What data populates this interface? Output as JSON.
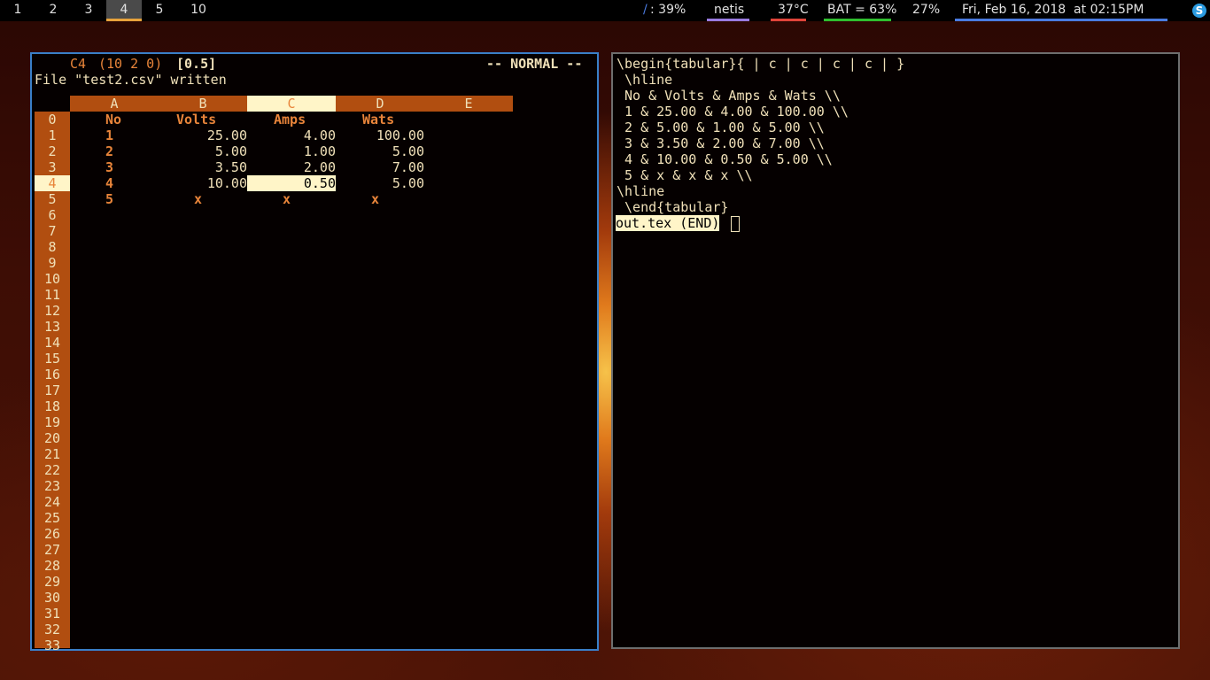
{
  "topbar": {
    "workspaces": [
      {
        "label": "1",
        "active": false
      },
      {
        "label": "2",
        "active": false
      },
      {
        "label": "3",
        "active": false
      },
      {
        "label": "4",
        "active": true
      },
      {
        "label": "5",
        "active": false
      },
      {
        "label": "10",
        "active": false
      }
    ],
    "disk": {
      "icon": "/",
      "value": ": 39%"
    },
    "net": "netis",
    "temp": "37°C",
    "battery": "BAT = 63%",
    "volume": "27%",
    "datetime": "Fri, Feb 16, 2018  at 02:15PM",
    "tray_icon": "skype-icon",
    "colors": {
      "net": "#9a7be0",
      "temp": "#e0443a",
      "battery": "#2fbf2f",
      "datetime": "#4a7be0",
      "disk_icon": "#4a7be0"
    }
  },
  "spreadsheet": {
    "status_cell": "C4",
    "status_info": "(10 2 0)",
    "status_value": "[0.5]",
    "mode": "-- NORMAL --",
    "message": "File \"test2.csv\" written",
    "columns": [
      "A",
      "B",
      "C",
      "D",
      "E"
    ],
    "selected_column": "C",
    "row_numbers": [
      "0",
      "1",
      "2",
      "3",
      "4",
      "5",
      "6",
      "7",
      "8",
      "9",
      "10",
      "11",
      "12",
      "13",
      "14",
      "15",
      "16",
      "17",
      "18",
      "19",
      "20",
      "21",
      "22",
      "23",
      "24",
      "25",
      "26",
      "27",
      "28",
      "29",
      "30",
      "31",
      "32",
      "33"
    ],
    "selected_row": "4",
    "header_row": [
      "No",
      "Volts",
      "Amps",
      "Wats"
    ],
    "rows": [
      [
        "1",
        "25.00",
        "4.00",
        "100.00"
      ],
      [
        "2",
        "5.00",
        "1.00",
        "5.00"
      ],
      [
        "3",
        "3.50",
        "2.00",
        "7.00"
      ],
      [
        "4",
        "10.00",
        "0.50",
        "5.00"
      ],
      [
        "5",
        "x",
        "x",
        "x"
      ]
    ]
  },
  "editor": {
    "lines": [
      "\\begin{tabular}{ | c | c | c | c | }",
      " \\hline",
      " No & Volts & Amps & Wats \\\\",
      " 1 & 25.00 & 4.00 & 100.00 \\\\",
      " 2 & 5.00 & 1.00 & 5.00 \\\\",
      " 3 & 3.50 & 2.00 & 7.00 \\\\",
      " 4 & 10.00 & 0.50 & 5.00 \\\\",
      " 5 & x & x & x \\\\",
      "\\hline",
      " \\end{tabular}"
    ],
    "status": "out.tex (END)"
  }
}
